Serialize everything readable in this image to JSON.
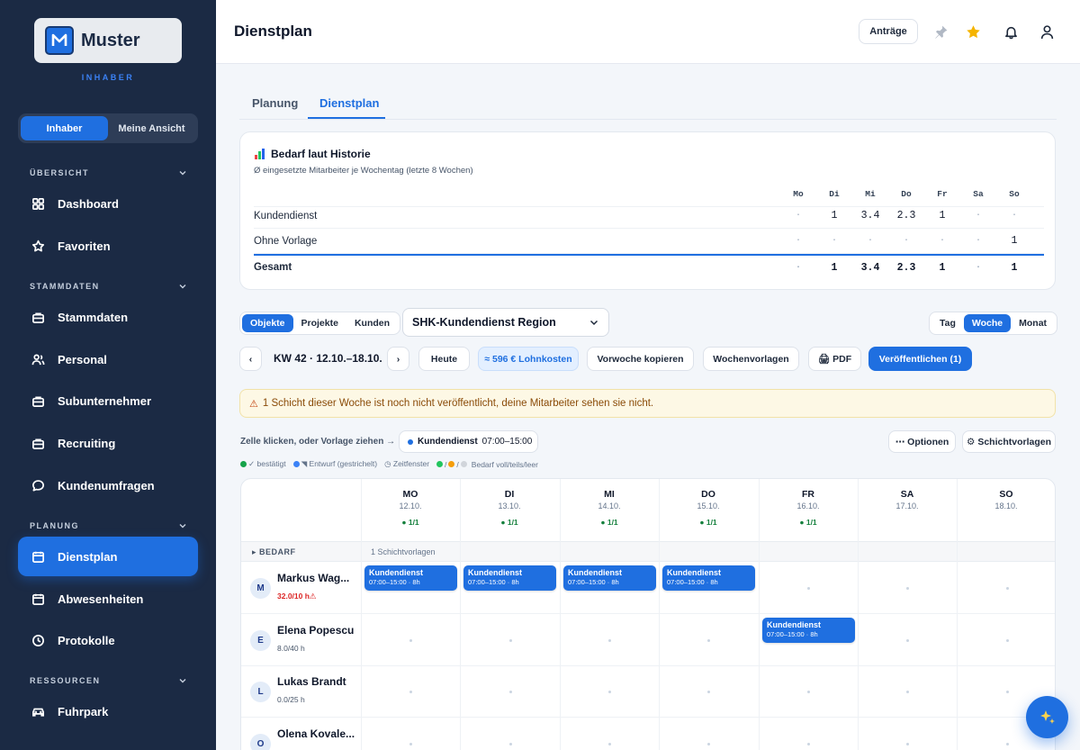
{
  "brand": {
    "name": "Muster",
    "role": "INHABER"
  },
  "role_toggle": {
    "owner": "Inhaber",
    "mine": "Meine Ansicht"
  },
  "sidebar": {
    "sections": [
      {
        "label": "ÜBERSICHT"
      },
      {
        "label": "STAMMDATEN"
      },
      {
        "label": "PLANUNG"
      },
      {
        "label": "RESSOURCEN"
      }
    ],
    "items": [
      {
        "label": "Dashboard",
        "icon": "grid-icon"
      },
      {
        "label": "Favoriten",
        "icon": "star-icon"
      },
      {
        "label": "Stammdaten",
        "icon": "briefcase-icon"
      },
      {
        "label": "Personal",
        "icon": "users-icon"
      },
      {
        "label": "Subunternehmer",
        "icon": "briefcase-icon"
      },
      {
        "label": "Recruiting",
        "icon": "briefcase-icon"
      },
      {
        "label": "Kundenumfragen",
        "icon": "chat-icon"
      },
      {
        "label": "Dienstplan",
        "icon": "calendar-icon",
        "active": true
      },
      {
        "label": "Abwesenheiten",
        "icon": "calendar-icon"
      },
      {
        "label": "Protokolle",
        "icon": "clock-icon"
      },
      {
        "label": "Fuhrpark",
        "icon": "car-icon"
      }
    ]
  },
  "header": {
    "title": "Dienstplan",
    "requests_label": "Anträge"
  },
  "tabs": [
    {
      "label": "Planung"
    },
    {
      "label": "Dienstplan",
      "active": true
    }
  ],
  "bedarf": {
    "title": "Bedarf laut Historie",
    "subtitle": "Ø eingesetzte Mitarbeiter je Wochentag (letzte 8 Wochen)",
    "days": [
      "Mo",
      "Di",
      "Mi",
      "Do",
      "Fr",
      "Sa",
      "So"
    ],
    "rows": [
      {
        "label": "Kundendienst",
        "values": [
          "·",
          "1",
          "3.4",
          "2.3",
          "1",
          "·",
          "·"
        ]
      },
      {
        "label": "Ohne Vorlage",
        "values": [
          "·",
          "·",
          "·",
          "·",
          "·",
          "·",
          "1"
        ]
      }
    ],
    "total": {
      "label": "Gesamt",
      "values": [
        "·",
        "1",
        "3.4",
        "2.3",
        "1",
        "·",
        "1"
      ]
    }
  },
  "filters": {
    "scope": [
      "Objekte",
      "Projekte",
      "Kunden"
    ],
    "object_select": "SHK-Kundendienst Region",
    "view": [
      "Tag",
      "Woche",
      "Monat"
    ]
  },
  "week_nav": {
    "prev": "‹",
    "next": "›",
    "label": "KW 42 · 12.10.–18.10.",
    "today": "Heute",
    "cost": "≈ 596 € Lohnkosten",
    "copy_prev": "Vorwoche kopieren",
    "templates": "Wochenvorlagen",
    "pdf": "🖨 PDF",
    "publish": "Veröffentlichen (1)"
  },
  "warning": {
    "icon": "⚠",
    "text": "1 Schicht dieser Woche ist noch nicht veröffentlicht, deine Mitarbeiter sehen sie nicht."
  },
  "hint": {
    "text": "Zelle klicken, oder Vorlage ziehen →",
    "chip_name": "Kundendienst",
    "chip_time": "07:00–15:00",
    "options": "⋯ Optionen",
    "shift_templates": "⚙ Schichtvorlagen"
  },
  "legend": {
    "confirmed": "✓ bestätigt",
    "draft": "◥ Entwurf (gestrichelt)",
    "window": "◷ Zeitfenster",
    "need": "Bedarf voll/teils/leer",
    "slash": "/"
  },
  "schedule": {
    "days": [
      {
        "name": "MO",
        "date": "12.10.",
        "status": "● 1/1"
      },
      {
        "name": "DI",
        "date": "13.10.",
        "status": "● 1/1"
      },
      {
        "name": "MI",
        "date": "14.10.",
        "status": "● 1/1"
      },
      {
        "name": "DO",
        "date": "15.10.",
        "status": "● 1/1"
      },
      {
        "name": "FR",
        "date": "16.10.",
        "status": "● 1/1"
      },
      {
        "name": "SA",
        "date": "17.10.",
        "status": ""
      },
      {
        "name": "SO",
        "date": "18.10.",
        "status": ""
      }
    ],
    "bedarf_label": "▸ BEDARF",
    "bedarf_value": "1 Schichtvorlagen",
    "employees": [
      {
        "initial": "M",
        "name": "Markus Wag...",
        "hours": "32.0/10 h⚠",
        "over": true,
        "shifts": [
          0,
          1,
          2,
          3
        ]
      },
      {
        "initial": "E",
        "name": "Elena Popescu",
        "hours": "8.0/40 h",
        "over": false,
        "shifts": [
          4
        ]
      },
      {
        "initial": "L",
        "name": "Lukas Brandt",
        "hours": "0.0/25 h",
        "over": false,
        "shifts": []
      },
      {
        "initial": "O",
        "name": "Olena Kovale...",
        "hours": "",
        "over": false,
        "shifts": []
      }
    ],
    "shift_name": "Kundendienst",
    "shift_time": "07:00–15:00 · 8h"
  },
  "colors": {
    "accent": "#1f6fe0",
    "sidebar": "#1b2a44",
    "warning_bg": "#fdf8e5",
    "ok": "#15803d",
    "over": "#dc2626",
    "star": "#f5b400"
  }
}
